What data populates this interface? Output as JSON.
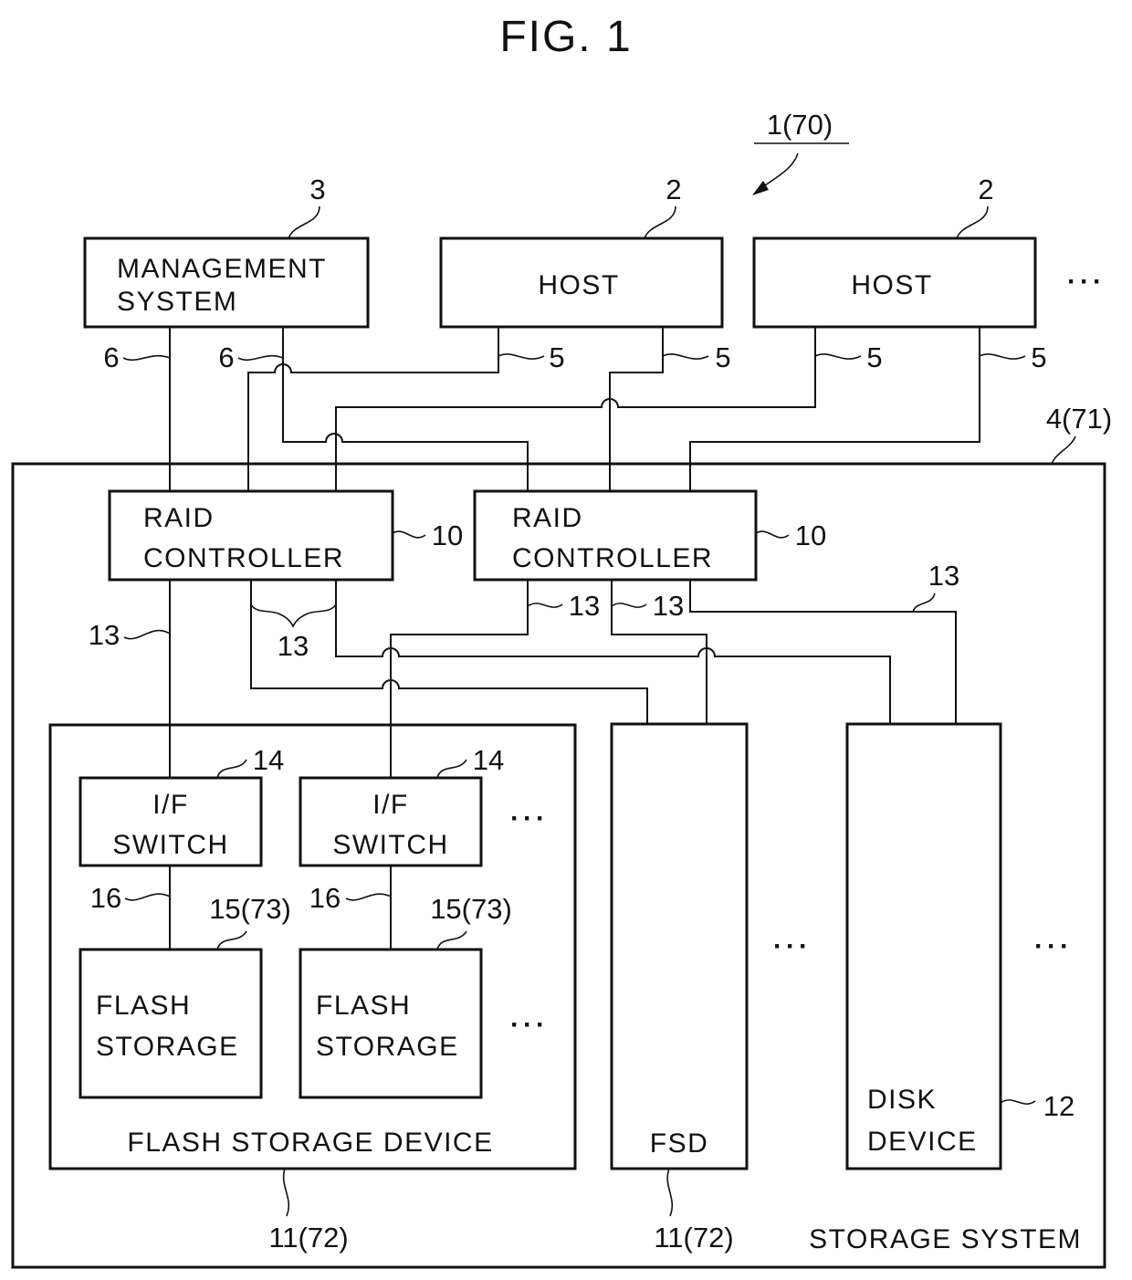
{
  "figure": {
    "title": "FIG. 1",
    "system_ref": "1(70)"
  },
  "management_system": {
    "label_line1": "MANAGEMENT",
    "label_line2": "SYSTEM",
    "ref": "3"
  },
  "hosts": [
    {
      "label": "HOST",
      "ref": "2"
    },
    {
      "label": "HOST",
      "ref": "2"
    }
  ],
  "ellipsis": "···",
  "connections": {
    "host_link_ref": "5",
    "mgmt_link_ref": "6",
    "drive_link_ref": "13",
    "internal_link_ref": "16"
  },
  "storage_system": {
    "label": "STORAGE SYSTEM",
    "ref": "4(71)"
  },
  "raid_controllers": [
    {
      "label_line1": "RAID",
      "label_line2": "CONTROLLER",
      "ref": "10"
    },
    {
      "label_line1": "RAID",
      "label_line2": "CONTROLLER",
      "ref": "10"
    }
  ],
  "flash_storage_device": {
    "label": "FLASH STORAGE DEVICE",
    "ref": "11(72)",
    "if_switches": [
      {
        "label_line1": "I/F",
        "label_line2": "SWITCH",
        "ref": "14"
      },
      {
        "label_line1": "I/F",
        "label_line2": "SWITCH",
        "ref": "14"
      }
    ],
    "flash_storages": [
      {
        "label_line1": "FLASH",
        "label_line2": "STORAGE",
        "ref": "15(73)"
      },
      {
        "label_line1": "FLASH",
        "label_line2": "STORAGE",
        "ref": "15(73)"
      }
    ]
  },
  "fsd": {
    "label": "FSD",
    "ref": "11(72)"
  },
  "disk_device": {
    "label_line1": "DISK",
    "label_line2": "DEVICE",
    "ref": "12"
  }
}
